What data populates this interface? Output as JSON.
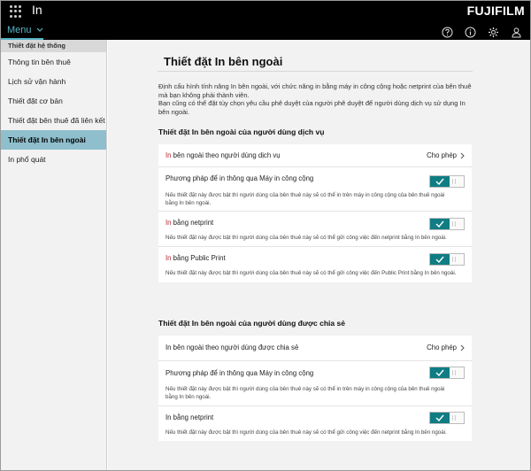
{
  "header": {
    "app_title": "In",
    "brand": "FUJIFILM",
    "menu_label": "Menu",
    "icons": [
      "apps-grid-icon",
      "help-icon",
      "info-icon",
      "settings-gear-icon",
      "user-icon"
    ]
  },
  "sidebar": {
    "heading": "Thiết đặt hệ thống",
    "items": [
      {
        "label": "Thông tin bên thuê"
      },
      {
        "label": "Lịch sử vận hành"
      },
      {
        "label": "Thiết đặt cơ bản"
      },
      {
        "label": "Thiết đặt bên thuê đã liên kết"
      },
      {
        "label": "Thiết đặt In bên ngoài",
        "active": true
      },
      {
        "label": "In phổ quát"
      }
    ]
  },
  "main": {
    "title": "Thiết đặt In bên ngoài",
    "description": "Định cấu hình tính năng In bên ngoài, với chức năng in bằng máy in công cộng hoặc netprint của bên thuê mà bạn không phải thành viên.\nBạn cũng có thể đặt tùy chọn yêu cầu phê duyệt của người phê duyệt để người dùng dịch vụ sử dụng In bên ngoài.",
    "sections": [
      {
        "title": "Thiết đặt In bên ngoài của người dùng dịch vụ",
        "rows": [
          {
            "label_accent": "In",
            "label_rest": " bên ngoài theo người dùng dịch vụ",
            "value": "Cho phép"
          },
          {
            "label": "Phương pháp để in thông qua Máy in công cộng",
            "toggle": true,
            "note": "Nếu thiết đặt này được bật thì người dùng của bên thuê này sẽ có thể in trên máy in công cộng của bên thuê ngoài bằng In bên ngoài."
          },
          {
            "label_accent": "In",
            "label_rest": " bằng netprint",
            "toggle": true,
            "note": "Nếu thiết đặt này được bật thì người dùng của bên thuê này sẽ có thể gửi công việc đến netprint bằng In bên ngoài."
          },
          {
            "label_accent": "In",
            "label_rest": " bằng Public Print",
            "toggle": true,
            "note": "Nếu thiết đặt này được bật thì người dùng của bên thuê này sẽ có thể gửi công việc đến Public Print bằng In bên ngoài."
          }
        ]
      },
      {
        "title": "Thiết đặt In bên ngoài của người dùng được chia sẻ",
        "rows": [
          {
            "label": "In bên ngoài theo người dùng được chia sẻ",
            "value": "Cho phép"
          },
          {
            "label": "Phương pháp để in thông qua Máy in công cộng",
            "toggle": true,
            "note": "Nếu thiết đặt này được bật thì người dùng của bên thuê này sẽ có thể in trên máy in công cộng của bên thuê ngoài bằng In bên ngoài."
          },
          {
            "label": "In bằng netprint",
            "toggle": true,
            "note": "Nếu thiết đặt này được bật thì người dùng của bên thuê này sẽ có thể gửi công việc đến netprint bằng In bên ngoài."
          }
        ]
      }
    ]
  },
  "colors": {
    "header_bg": "#000000",
    "menu_accent": "#5ab3c8",
    "active_nav": "#8fbfcd",
    "toggle_on": "#0f7d83",
    "label_accent": "#b5282f"
  }
}
